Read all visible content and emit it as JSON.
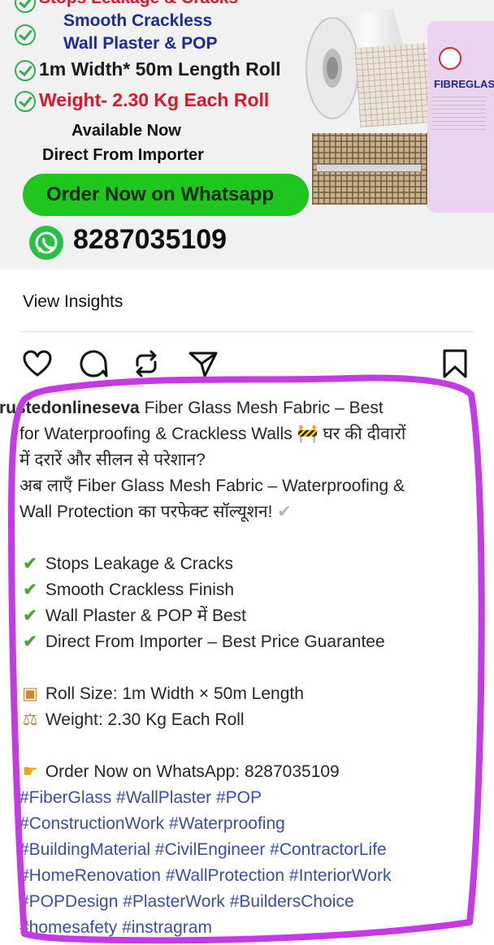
{
  "promo": {
    "top_bullet": "Stops Leakage & Cracks",
    "bullet_blue_1": "Smooth Crackless",
    "bullet_blue_2": "Wall Plaster & POP",
    "bullet_size": "1m Width* 50m Length Roll",
    "bullet_weight": "Weight- 2.30 Kg Each Roll",
    "available_1": "Available Now",
    "available_2": "Direct From Importer",
    "order_button": "Order Now on Whatsapp",
    "phone": "8287035109",
    "package_brand": "FIBREGLAS",
    "accent_green": "#1ec61e",
    "text_red": "#e0152a",
    "text_blue": "#1d2a9e"
  },
  "post": {
    "view_insights": "View Insights",
    "actions": [
      "like-icon",
      "comment-icon",
      "repost-icon",
      "share-icon",
      "save-icon"
    ]
  },
  "caption": {
    "username": "trustedonlineseva",
    "intro_1": " Fiber Glass Mesh Fabric – Best",
    "intro_2": "for Waterproofing & Crackless Walls ",
    "intro_2_hindi": " घर की दीवारों",
    "hindi_1": "में दरारें और सीलन से परेशान?",
    "hindi_2": "अब लाएँ Fiber Glass Mesh Fabric – Waterproofing &",
    "hindi_3": "Wall Protection का परफेक्ट सॉल्यूशन! ",
    "feature_1": "Stops Leakage & Cracks",
    "feature_2": "Smooth Crackless Finish",
    "feature_3": "Wall Plaster & POP में Best",
    "feature_4": "Direct From Importer – Best Price Guarantee",
    "roll_size": "Roll Size: 1m Width × 50m Length",
    "weight": "Weight: 2.30 Kg Each Roll",
    "order": "Order Now on WhatsApp: 8287035109",
    "hashtags": [
      "#FiberGlass #WallPlaster #POP",
      "#ConstructionWork #Waterproofing",
      "#BuildingMaterial #CivilEngineer #ContractorLife",
      "#HomeRenovation #WallProtection #InteriorWork",
      "#POPDesign #PlasterWork #BuildersChoice",
      "#homesafety #instragram"
    ],
    "hashtag_color": "#3b4ea6",
    "highlight_color": "#c43be6"
  }
}
